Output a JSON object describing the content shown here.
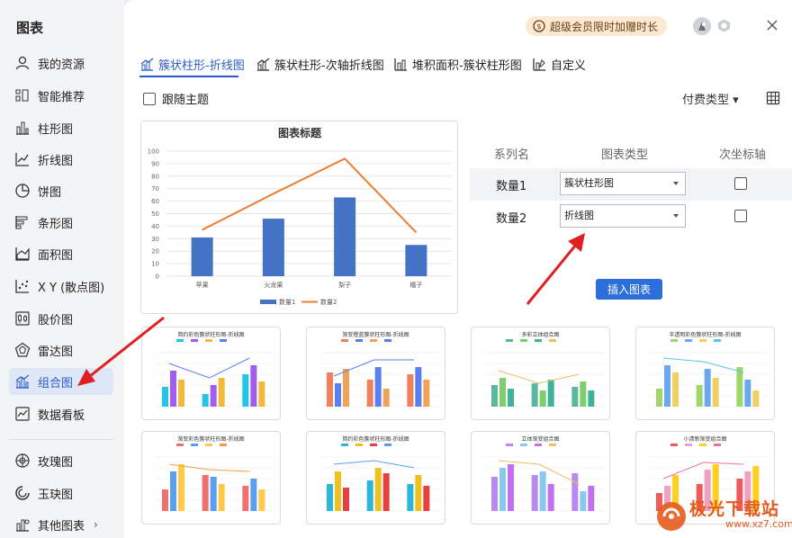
{
  "sidebar": {
    "title": "图表",
    "items": [
      {
        "label": "我的资源",
        "icon": "user-icon"
      },
      {
        "label": "智能推荐",
        "icon": "smart-recommend-icon"
      },
      {
        "label": "柱形图",
        "icon": "column-chart-icon"
      },
      {
        "label": "折线图",
        "icon": "line-chart-icon"
      },
      {
        "label": "饼图",
        "icon": "pie-chart-icon"
      },
      {
        "label": "条形图",
        "icon": "bar-chart-icon"
      },
      {
        "label": "面积图",
        "icon": "area-chart-icon"
      },
      {
        "label": "X Y (散点图)",
        "icon": "scatter-chart-icon"
      },
      {
        "label": "股价图",
        "icon": "stock-chart-icon"
      },
      {
        "label": "雷达图",
        "icon": "radar-chart-icon"
      },
      {
        "label": "组合图",
        "icon": "combo-chart-icon",
        "active": true
      },
      {
        "label": "数据看板",
        "icon": "dashboard-icon"
      },
      {
        "label": "玫瑰图",
        "icon": "rose-chart-icon"
      },
      {
        "label": "玉玦图",
        "icon": "jade-ring-chart-icon"
      },
      {
        "label": "其他图表",
        "icon": "other-charts-icon"
      }
    ]
  },
  "header": {
    "vip_label": "超级会员限时加赠时长"
  },
  "tabs": [
    {
      "label": "簇状柱形-折线图",
      "active": true
    },
    {
      "label": "簇状柱形-次轴折线图"
    },
    {
      "label": "堆积面积-簇状柱形图"
    },
    {
      "label": "自定义"
    }
  ],
  "toolbar": {
    "follow_theme_label": "跟随主题",
    "pay_type_label": "付费类型 ▾"
  },
  "chart_data": {
    "type": "bar",
    "title": "图表标题",
    "categories": [
      "苹果",
      "火龙果",
      "梨子",
      "橘子"
    ],
    "series": [
      {
        "name": "数量1",
        "type": "bar",
        "values": [
          31,
          46,
          63,
          25
        ]
      },
      {
        "name": "数量2",
        "type": "line",
        "values": [
          37,
          66,
          94,
          35
        ]
      }
    ],
    "ylim": [
      0,
      100
    ],
    "yticks": [
      0,
      10,
      20,
      30,
      40,
      50,
      60,
      70,
      80,
      90,
      100
    ],
    "legend": "bottom",
    "grid": true,
    "colors": {
      "bar": "#4472c4",
      "line": "#ed7d31"
    }
  },
  "series_table": {
    "headers": [
      "系列名",
      "图表类型",
      "次坐标轴"
    ],
    "rows": [
      {
        "name": "数量1",
        "type": "簇状柱形图",
        "secondary": false
      },
      {
        "name": "数量2",
        "type": "折线图",
        "secondary": false
      }
    ]
  },
  "insert_button": "插入图表",
  "templates": [
    {
      "title": "简约彩色簇状柱形图-折线图"
    },
    {
      "title": "渐变橙蓝簇状柱形图-折线图"
    },
    {
      "title": "多彩立体组合图"
    },
    {
      "title": "半透明彩色簇状柱形图-折线图"
    },
    {
      "title": "渐变彩色簇状柱形图-折线图"
    },
    {
      "title": "简约彩色簇状柱形图-折线图"
    },
    {
      "title": "立体渐变组合图"
    },
    {
      "title": "小清新渐变组合图"
    }
  ],
  "watermark": {
    "text": "极光下载站",
    "url": "www.xz7.com"
  }
}
